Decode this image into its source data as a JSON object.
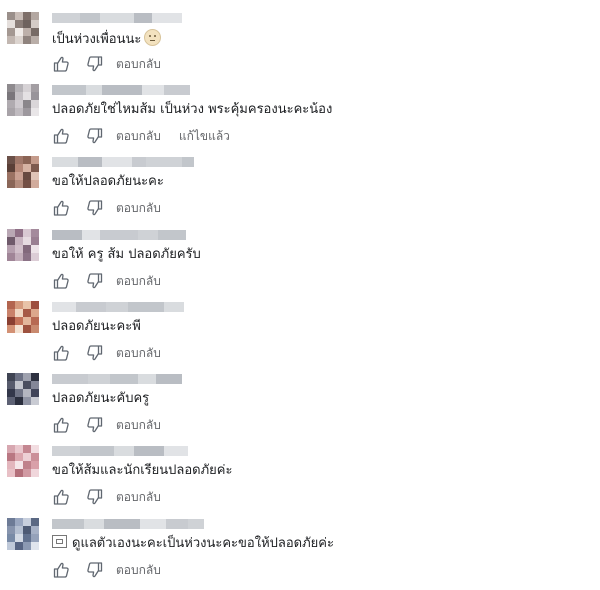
{
  "actions": {
    "like_icon": "thumbs-up-icon",
    "dislike_icon": "thumbs-down-icon",
    "reply_label": "ตอบกลับ",
    "edit_label": "แก้ไขแล้ว"
  },
  "colors": {
    "text": "#1c1e21",
    "secondary_text": "#65676b",
    "blurred_name": "#cdd0d4"
  },
  "comments": [
    {
      "text": "เป็นห่วงเพื่อนนะ",
      "emoji": "slightly-smiling-face-icon",
      "edited": false
    },
    {
      "text": "ปลอดภัยใช่ไหมส้ม เป็นห่วง พระคุ้มครองนะคะน้อง",
      "edited": true
    },
    {
      "text": "ขอให้ปลอดภัยนะคะ",
      "edited": false
    },
    {
      "text": "ขอให้ ครู ส้ม ปลอดภัยครับ",
      "edited": false
    },
    {
      "text": "ปลอดภัยนะคะพี",
      "edited": false
    },
    {
      "text": "ปลอดภัยนะคับครู",
      "edited": false
    },
    {
      "text": "ขอให้ส้มและนักเรียนปลอดภัยค่ะ",
      "edited": false
    },
    {
      "text": "ดูแลตัวเองนะคะเป็นห่วงนะคะขอให้ปลอดภัยค่ะ",
      "prefix_icon": "broken-image-icon",
      "edited": false
    }
  ]
}
